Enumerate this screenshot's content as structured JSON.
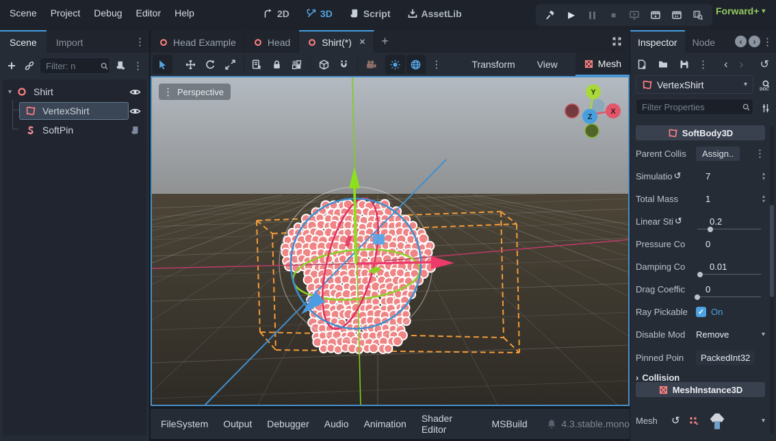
{
  "colors": {
    "accent_blue": "#53a4e0",
    "node_red": "#fc7f7f",
    "renderer_green": "#95c95f",
    "gizmo_orange": "#ffa13a",
    "axis_x_red": "#e0315f",
    "axis_y_green": "#8ed028",
    "axis_z_blue": "#3e8fd0",
    "softbody_dot_pink": "#ef8585"
  },
  "menubar": {
    "menus": [
      "Scene",
      "Project",
      "Debug",
      "Editor",
      "Help"
    ],
    "workspaces": [
      {
        "label": "2D",
        "icon": "workspace-2d-icon",
        "active": false
      },
      {
        "label": "3D",
        "icon": "workspace-3d-icon",
        "active": true
      },
      {
        "label": "Script",
        "icon": "workspace-script-icon",
        "active": false
      },
      {
        "label": "AssetLib",
        "icon": "workspace-assetlib-icon",
        "active": false
      }
    ],
    "playback_icons": [
      "build-export-icon",
      "play-icon",
      "pause-icon",
      "stop-icon",
      "play-remote-icon",
      "play-scene-icon",
      "play-custom-scene-icon",
      "movie-maker-icon"
    ],
    "renderer": {
      "label": "Forward+",
      "icon": "chevron-down-icon"
    }
  },
  "scene_dock": {
    "tabs": [
      {
        "label": "Scene",
        "active": true
      },
      {
        "label": "Import",
        "active": false
      }
    ],
    "toolbar": {
      "filter_placeholder": "Filter: n",
      "icons": [
        "add-node-icon",
        "instance-scene-icon",
        "search-icon",
        "attach-script-icon",
        "more-icon"
      ]
    },
    "tree": [
      {
        "label": "Shirt",
        "icon": "node3d-icon",
        "right_icon": "eye-icon",
        "selected": false
      },
      {
        "label": "VertexShirt",
        "icon": "softbody3d-icon",
        "right_icon": "eye-icon",
        "selected": true
      },
      {
        "label": "SoftPin",
        "icon": "softpin-icon",
        "right_icon": "script-icon",
        "selected": false
      }
    ]
  },
  "viewport": {
    "scene_tabs": [
      {
        "label": "Head Example",
        "active": false
      },
      {
        "label": "Head",
        "active": false
      },
      {
        "label": "Shirt(*)",
        "active": true,
        "closable": true
      }
    ],
    "menus": [
      {
        "label": "Transform",
        "active": false
      },
      {
        "label": "View",
        "active": false
      },
      {
        "label": "Mesh",
        "active": true,
        "icon": "mesh-icon"
      }
    ],
    "toolbar_icons": [
      "select-tool-icon",
      "move-tool-icon",
      "rotate-tool-icon",
      "scale-tool-icon",
      "list-select-icon",
      "lock-icon",
      "group-icon",
      "local-space-icon",
      "snap-icon",
      "preview-camera-icon",
      "sun-icon",
      "environment-icon",
      "more-icon"
    ],
    "perspective_label": "Perspective",
    "axis_labels": {
      "y": "Y",
      "x": "X",
      "z": "Z"
    }
  },
  "inspector": {
    "tabs": [
      {
        "label": "Inspector",
        "active": true
      },
      {
        "label": "Node",
        "active": false
      }
    ],
    "toolbar_icons": [
      "new-resource-icon",
      "load-resource-icon",
      "save-resource-icon",
      "more-icon",
      "history-back-icon",
      "history-forward-icon",
      "object-history-icon",
      "open-docs-icon",
      "manage-properties-icon"
    ],
    "object": {
      "name": "VertexShirt"
    },
    "filter_placeholder": "Filter Properties",
    "class_header": {
      "label": "SoftBody3D"
    },
    "properties": [
      {
        "label": "Parent Collis",
        "value": "Assign..",
        "control": "assign-button"
      },
      {
        "label": "Simulatio",
        "value": "7",
        "control": "spinbox",
        "revert": true
      },
      {
        "label": "Total Mass",
        "value": "1",
        "control": "spinbox"
      },
      {
        "label": "Linear Sti",
        "value": "0.2",
        "control": "slider",
        "revert": true,
        "slider_pos": 0.2
      },
      {
        "label": "Pressure Co",
        "value": "0",
        "control": "plain"
      },
      {
        "label": "Damping Co",
        "value": "0.01",
        "control": "slider",
        "slider_pos": 0.04
      },
      {
        "label": "Drag Coeffic",
        "value": "0",
        "control": "slider",
        "slider_pos": 0
      },
      {
        "label": "Ray Pickable",
        "value": "On",
        "control": "checkbox",
        "checked": true
      },
      {
        "label": "Disable Mod",
        "value": "Remove",
        "control": "dropdown"
      },
      {
        "label": "Pinned Poin",
        "value": "PackedInt32",
        "control": "plain"
      }
    ],
    "collision_group": {
      "label": "Collision"
    },
    "mesh_header": {
      "label": "MeshInstance3D"
    },
    "mesh_property": {
      "label": "Mesh"
    }
  },
  "bottom_bar": {
    "buttons": [
      "FileSystem",
      "Output",
      "Debugger",
      "Audio",
      "Animation",
      "Shader Editor",
      "MSBuild"
    ],
    "version": "4.3.stable.mono"
  }
}
